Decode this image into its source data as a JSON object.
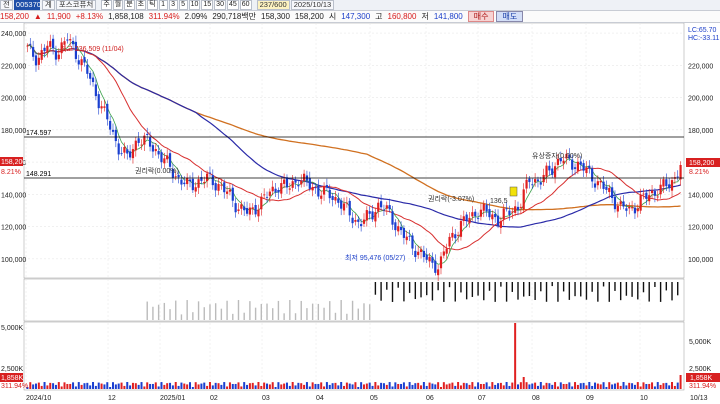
{
  "toolbar": {
    "combo_label": "전",
    "code": "005370",
    "tabs": [
      "계",
      "포스코퓨처"
    ],
    "period_buttons": [
      "주",
      "월",
      "분",
      "초",
      "틱",
      "1",
      "3",
      "5",
      "10",
      "15",
      "30",
      "45",
      "60"
    ],
    "selected_period": "일",
    "count": "237/600",
    "date": "2025/10/13"
  },
  "info": {
    "price": "158,200",
    "change": "11,900",
    "change_pct": "+8.13%",
    "volume": "1,858,108",
    "turnover_pct": "311.94%",
    "value_pct": "2.09%",
    "amount": "290,718백만",
    "high_label": "시",
    "open": "158,300",
    "open2": "158,200",
    "high": "147,300",
    "low_label": "고",
    "low": "160,800",
    "close_label": "저",
    "last": "141,800",
    "buy_label": "매수",
    "sell_label": "매도"
  },
  "axis_right": {
    "top_labels": [
      "LC:65.70",
      "HC:-33.11"
    ],
    "ticks": [
      "220,000",
      "200,000",
      "180,000",
      "160,000",
      "140,000",
      "120,000",
      "100,000"
    ],
    "current": "158,200",
    "current_pct": "8.21%",
    "vol_ticks": [
      "5,000K",
      "2,500K"
    ],
    "vol_current": "1,858K",
    "vol_pct": "311.94%"
  },
  "axis_left": {
    "ticks": [
      "240,000",
      "220,000",
      "200,000",
      "180,000",
      "160,000",
      "140,000",
      "120,000",
      "100,000"
    ],
    "vol_ticks": [
      "5,000K",
      "2,500K"
    ],
    "price_box": "158,200",
    "price_pct": "8.21%",
    "vol_box": "1,858K",
    "vol_pct": "311.94%"
  },
  "lines": {
    "h1": "174.597",
    "h2": "148.291"
  },
  "annotations": {
    "high": "최고 236,509 (11/04)",
    "low": "최저 95,476 (05/27)",
    "rights": "권리락(-3.07%)",
    "rights2": "권리락(0.00%)",
    "offering": "유상증자(0.00%)",
    "mark": "136,5"
  },
  "x_axis": [
    "2024/10",
    "12",
    "2025/01",
    "02",
    "03",
    "04",
    "05",
    "06",
    "07",
    "08",
    "09",
    "10",
    "10/13"
  ],
  "colors": {
    "up": "#e02020",
    "down": "#1a3fd0",
    "ma5": "#d83030",
    "ma20": "#2a2aa8",
    "ma60": "#e08a20",
    "ma120": "#d07020"
  },
  "chart_data": {
    "type": "line",
    "title": "",
    "ylim": [
      90000,
      245000
    ],
    "series": [
      {
        "values": [
          230000,
          224000,
          232000,
          228000,
          236509,
          226000,
          215000,
          200000,
          185000,
          170000,
          162000,
          175000,
          172000,
          166000,
          158000,
          150000,
          145000,
          148000,
          150000,
          146000,
          140000,
          132000,
          128000,
          134000,
          140000,
          146000,
          144000,
          150000,
          146000,
          142000,
          140000,
          136000,
          128000,
          122000,
          126000,
          134000,
          128000,
          118000,
          110000,
          104000,
          98000,
          95476,
          112000,
          120000,
          126000,
          130000,
          128000,
          124000,
          130000,
          133000,
          150000,
          148000,
          155000,
          162000,
          160000,
          158000,
          152000,
          146000,
          140000,
          132000,
          130000,
          136000,
          140000,
          144000,
          146000,
          158200
        ]
      }
    ]
  }
}
